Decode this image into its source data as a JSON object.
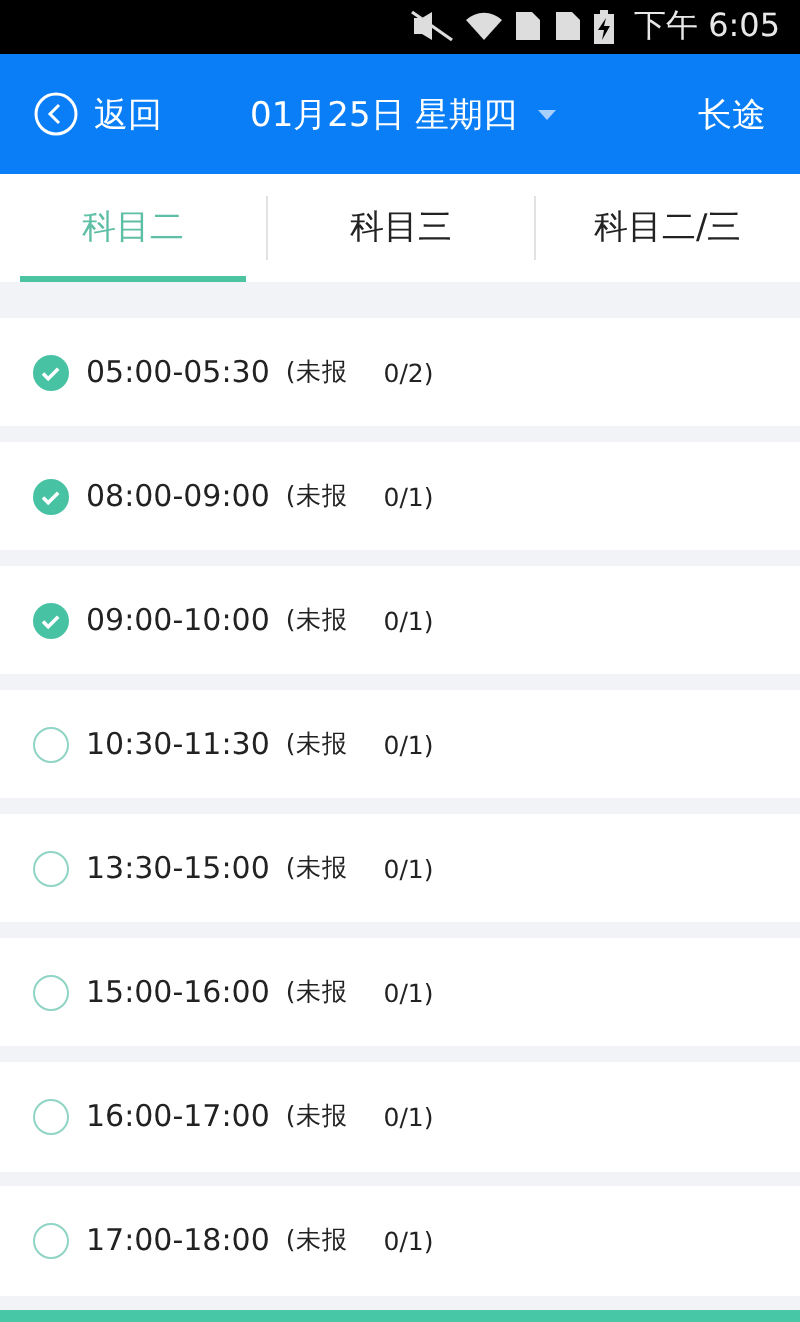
{
  "status_bar": {
    "time": "下午 6:05"
  },
  "header": {
    "back": "返回",
    "date": "01月25日 星期四",
    "right": "长途"
  },
  "tabs": [
    {
      "label": "科目二",
      "selected": true
    },
    {
      "label": "科目三",
      "selected": false
    },
    {
      "label": "科目二/三",
      "selected": false
    }
  ],
  "slots": [
    {
      "time": "05:00-05:30",
      "status": "(未报",
      "count": "0/2)",
      "checked": true
    },
    {
      "time": "08:00-09:00",
      "status": "(未报",
      "count": "0/1)",
      "checked": true
    },
    {
      "time": "09:00-10:00",
      "status": "(未报",
      "count": "0/1)",
      "checked": true
    },
    {
      "time": "10:30-11:30",
      "status": "(未报",
      "count": "0/1)",
      "checked": false
    },
    {
      "time": "13:30-15:00",
      "status": "(未报",
      "count": "0/1)",
      "checked": false
    },
    {
      "time": "15:00-16:00",
      "status": "(未报",
      "count": "0/1)",
      "checked": false
    },
    {
      "time": "16:00-17:00",
      "status": "(未报",
      "count": "0/1)",
      "checked": false
    },
    {
      "time": "17:00-18:00",
      "status": "(未报",
      "count": "0/1)",
      "checked": false
    }
  ]
}
